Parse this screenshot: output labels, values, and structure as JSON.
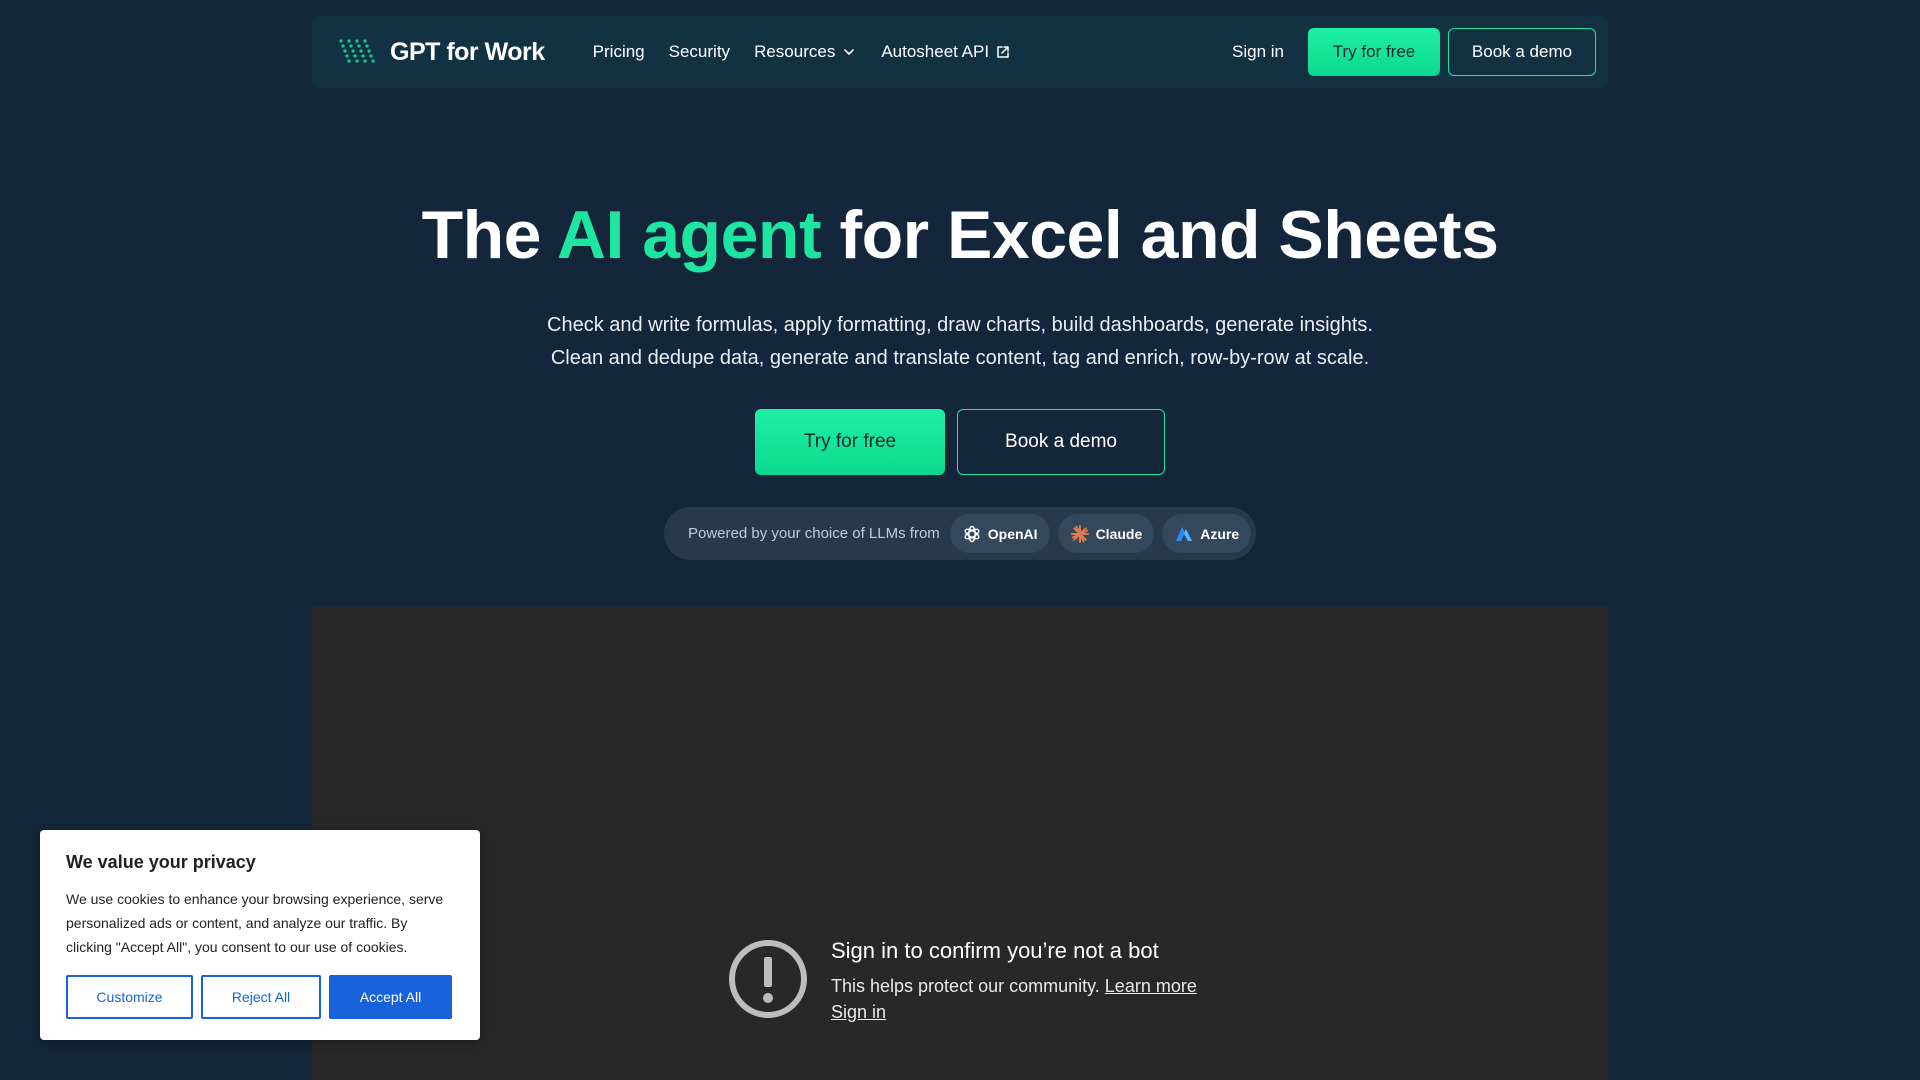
{
  "nav": {
    "logo_text": "GPT for Work",
    "links": [
      {
        "label": "Pricing"
      },
      {
        "label": "Security"
      },
      {
        "label": "Resources",
        "icon": "chevron-down-icon"
      },
      {
        "label": "Autosheet API",
        "icon": "external-link-icon"
      }
    ],
    "sign_in": "Sign in",
    "try_free": "Try for free",
    "book_demo": "Book a demo"
  },
  "hero": {
    "title_before": "The ",
    "title_accent": "AI agent",
    "title_after": " for Excel and Sheets",
    "subtitle_line1": "Check and write formulas, apply formatting, draw charts, build dashboards, generate insights.",
    "subtitle_line2": "Clean and dedupe data, generate and translate content, tag and enrich, row-by-row at scale.",
    "try_free": "Try for free",
    "book_demo": "Book a demo"
  },
  "llm": {
    "text": "Powered by your choice of LLMs from",
    "providers": [
      {
        "name": "OpenAI",
        "icon": "openai-icon"
      },
      {
        "name": "Claude",
        "icon": "claude-icon"
      },
      {
        "name": "Azure",
        "icon": "azure-icon"
      }
    ]
  },
  "video": {
    "title": "Sign in to confirm you’re not a bot",
    "desc": "This helps protect our community.",
    "learn_more": "Learn more",
    "sign_in": "Sign in"
  },
  "cookie": {
    "title": "We value your privacy",
    "text": "We use cookies to enhance your browsing experience, serve personalized ads or content, and analyze our traffic. By clicking \"Accept All\", you consent to our use of cookies.",
    "customize": "Customize",
    "reject": "Reject All",
    "accept": "Accept All"
  },
  "colors": {
    "background": "#14263b",
    "nav": "#123244",
    "accent": "#1ee6a0",
    "cookie_blue": "#1863dc"
  }
}
